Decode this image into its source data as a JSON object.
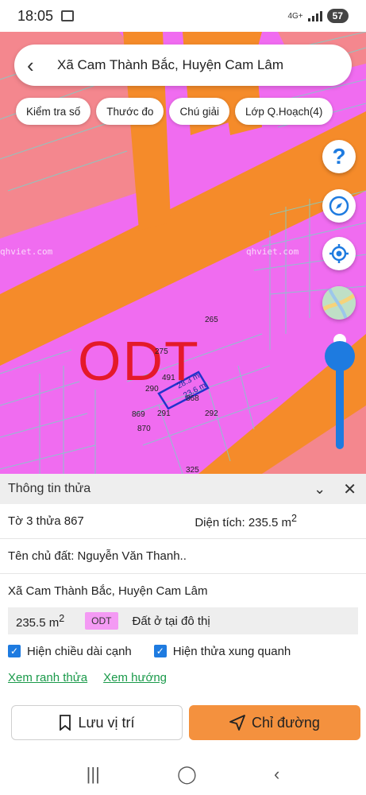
{
  "status_bar": {
    "time": "18:05",
    "network": "4G+",
    "battery": "57"
  },
  "header": {
    "title": "Xã Cam Thành Bắc, Huyện Cam Lâm"
  },
  "chips": [
    {
      "label": "Kiểm tra số"
    },
    {
      "label": "Thước đo"
    },
    {
      "label": "Chú giải"
    },
    {
      "label": "Lớp Q.Hoạch(4)"
    }
  ],
  "map": {
    "zone_code": "ODT",
    "watermark": "qhviet.com",
    "edge_lengths": [
      "28.3 m",
      "23.6 m"
    ],
    "parcel_labels": [
      "265",
      "275",
      "491",
      "290",
      "868",
      "869",
      "291",
      "292",
      "870",
      "325"
    ],
    "colors": {
      "residential": "#f06cf0",
      "road": "#f58b2a",
      "salmon": "#f4878e",
      "selected_outline": "#2233cc"
    }
  },
  "sheet": {
    "title": "Thông tin thửa",
    "sheet_parcel": "Tờ 3 thửa 867",
    "area_label": "Diện tích: 235.5 m",
    "area_sup": "2",
    "owner": "Tên chủ đất: Nguyễn Văn Thanh..",
    "location": "Xã Cam Thành Bắc, Huyện Cam Lâm",
    "land_area": "235.5 m",
    "land_area_sup": "2",
    "land_code": "ODT",
    "land_desc": "Đất ở tại đô thị",
    "checkboxes": [
      {
        "label": "Hiện chiều dài cạnh",
        "checked": true
      },
      {
        "label": "Hiện thửa xung quanh",
        "checked": true
      }
    ],
    "links": [
      {
        "label": "Xem ranh thửa"
      },
      {
        "label": "Xem hướng"
      }
    ],
    "save_label": "Lưu vị trí",
    "route_label": "Chỉ đường"
  }
}
